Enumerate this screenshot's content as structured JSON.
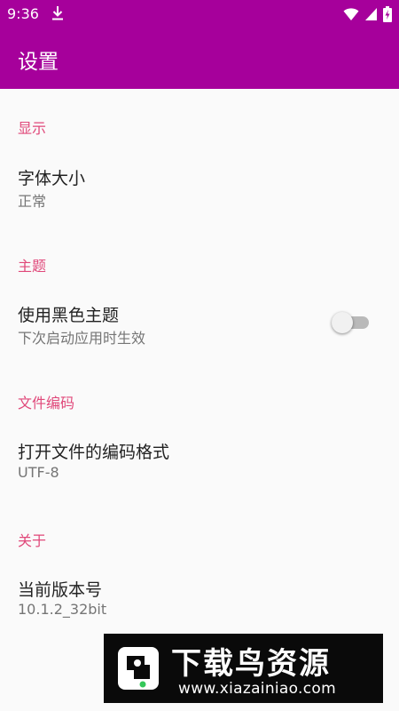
{
  "status_bar": {
    "time": "9:36",
    "icons": [
      "download-icon",
      "wifi-icon",
      "cell-signal-icon",
      "battery-charging-icon"
    ]
  },
  "app_bar": {
    "title": "设置"
  },
  "sections": [
    {
      "header": "显示",
      "pref": {
        "title": "字体大小",
        "summary": "正常"
      }
    },
    {
      "header": "主题",
      "pref": {
        "title": "使用黑色主题",
        "summary": "下次启动应用时生效",
        "switch_on": false
      }
    },
    {
      "header": "文件编码",
      "pref": {
        "title": "打开文件的编码格式",
        "summary": "UTF-8"
      }
    },
    {
      "header": "关于",
      "pref": {
        "title": "当前版本号",
        "summary": "10.1.2_32bit"
      }
    }
  ],
  "watermark": {
    "title": "下载鸟资源",
    "url": "www.xiazainiao.com"
  },
  "colors": {
    "primary": "#a6009b",
    "accent": "#e0487a",
    "background": "#fafafa"
  }
}
